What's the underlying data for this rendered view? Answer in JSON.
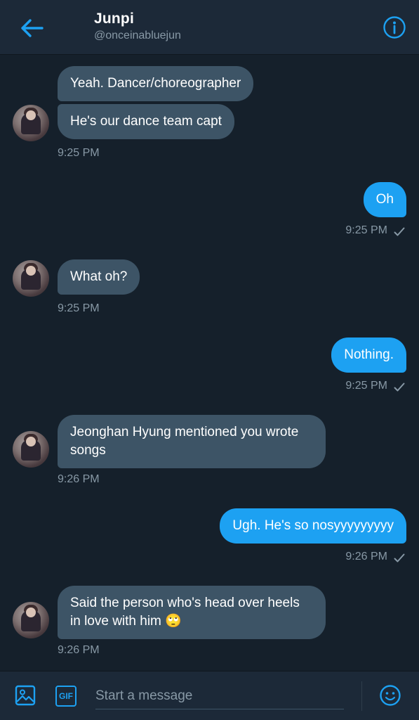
{
  "header": {
    "title": "Junpi",
    "handle": "@onceinabluejun"
  },
  "messages": [
    {
      "id": "m1",
      "direction": "in",
      "text": "Yeah. Dancer/choreographer"
    },
    {
      "id": "m2",
      "direction": "in",
      "text": "He's our dance team capt",
      "time": "9:25 PM"
    },
    {
      "id": "m3",
      "direction": "out",
      "text": "Oh",
      "time": "9:25 PM",
      "status": "sent"
    },
    {
      "id": "m4",
      "direction": "in",
      "text": "What oh?",
      "time": "9:25 PM"
    },
    {
      "id": "m5",
      "direction": "out",
      "text": "Nothing.",
      "time": "9:25 PM",
      "status": "sent"
    },
    {
      "id": "m6",
      "direction": "in",
      "text": "Jeonghan Hyung mentioned you wrote songs",
      "time": "9:26 PM"
    },
    {
      "id": "m7",
      "direction": "out",
      "text": "Ugh. He's so nosyyyyyyyyy",
      "time": "9:26 PM",
      "status": "sent"
    },
    {
      "id": "m8",
      "direction": "in",
      "text": "Said the person who's head over heels in love with him",
      "emoji": "🙄",
      "time": "9:26 PM"
    }
  ],
  "composer": {
    "placeholder": "Start a message",
    "gif_label": "GIF"
  },
  "icons": {
    "back": "arrow-left-icon",
    "info": "info-icon",
    "image": "image-icon",
    "gif": "gif-icon",
    "emoji": "emoji-icon",
    "check": "check-icon"
  },
  "colors": {
    "background": "#15202b",
    "header": "#1c2938",
    "incoming_bubble": "#3d5466",
    "outgoing_bubble": "#1da1f2",
    "accent": "#1da1f2",
    "secondary_text": "#8899a6"
  }
}
